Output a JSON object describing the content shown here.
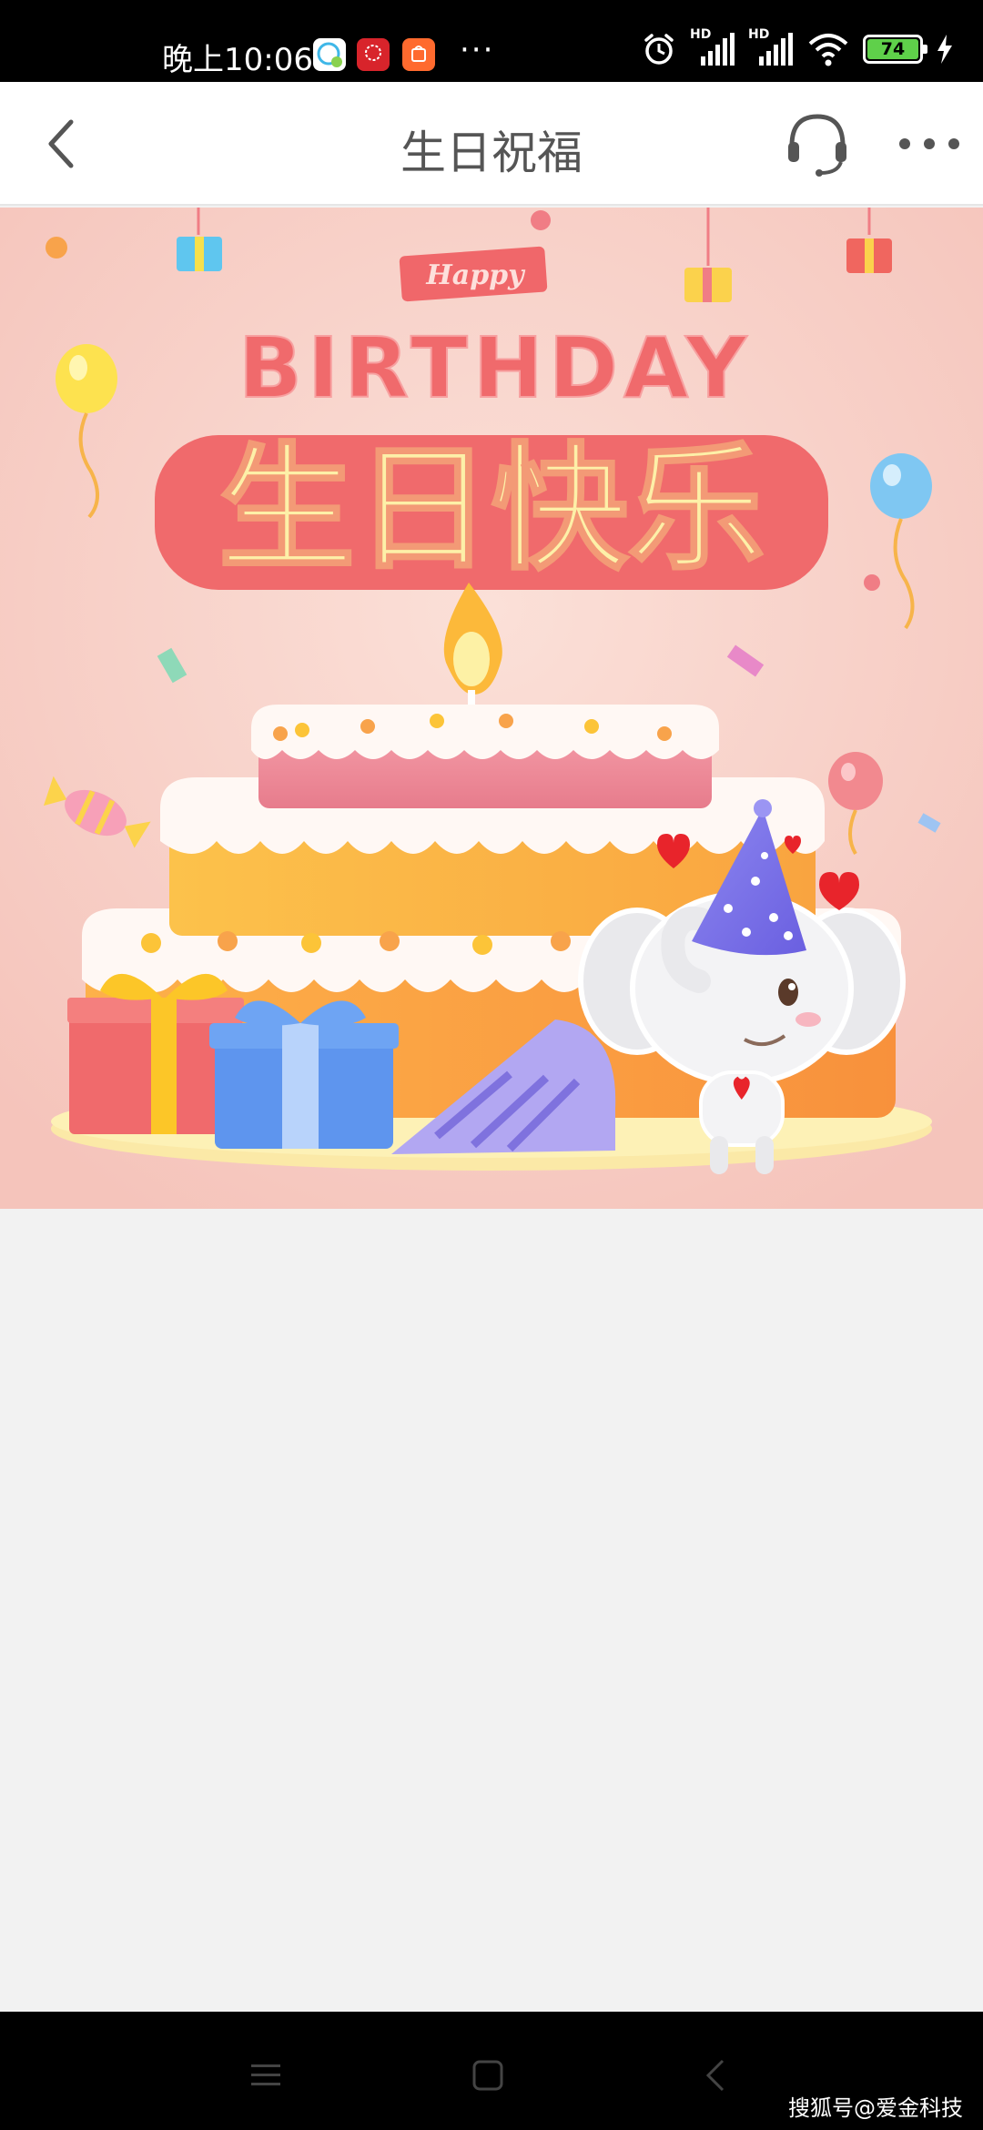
{
  "status_bar": {
    "time": "晚上10:06",
    "more": "···",
    "signal_1": "HD",
    "signal_2": "HD",
    "battery": "74"
  },
  "header": {
    "title": "生日祝福",
    "back_icon": "chevron-left-icon",
    "support_icon": "headset-icon",
    "more_icon": "more-dots-icon"
  },
  "banner": {
    "happy": "Happy",
    "birthday": "BIRTHDAY",
    "greeting": "生日快乐"
  },
  "nav_bar": {
    "menu_icon": "menu-icon",
    "home_icon": "home-square-icon",
    "back_icon": "back-triangle-icon"
  },
  "watermark": "搜狐号@爱金科技",
  "colors": {
    "banner_bg": "#f9d2c8",
    "title_red": "#ef6a68",
    "title_yellow": "#fdf0a8",
    "cake_pink": "#ee8c9c",
    "cake_orange": "#fdb64a"
  }
}
